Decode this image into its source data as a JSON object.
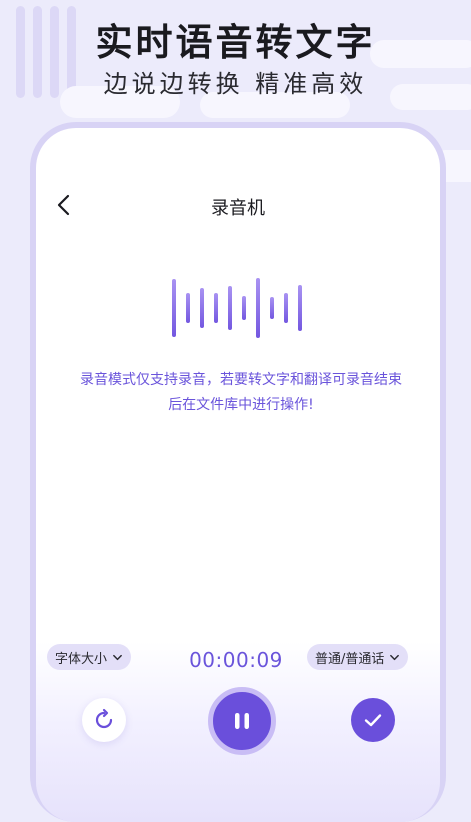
{
  "banner": {
    "title": "实时语音转文字",
    "subtitle": "边说边转换 精准高效"
  },
  "screen": {
    "title": "录音机",
    "hint": "录音模式仅支持录音，若要转文字和翻译可录音结束后在文件库中进行操作!"
  },
  "controls": {
    "font_size_label": "字体大小",
    "timer": "00:00:09",
    "language_label": "普通/普通话"
  },
  "colors": {
    "accent": "#6a4fdb",
    "hint_text": "#6a54db",
    "background": "#ecebfb"
  },
  "icons": {
    "back": "chevron-left-icon",
    "reset": "refresh-icon",
    "pause": "pause-icon",
    "confirm": "check-icon",
    "dropdown": "chevron-down-icon"
  }
}
